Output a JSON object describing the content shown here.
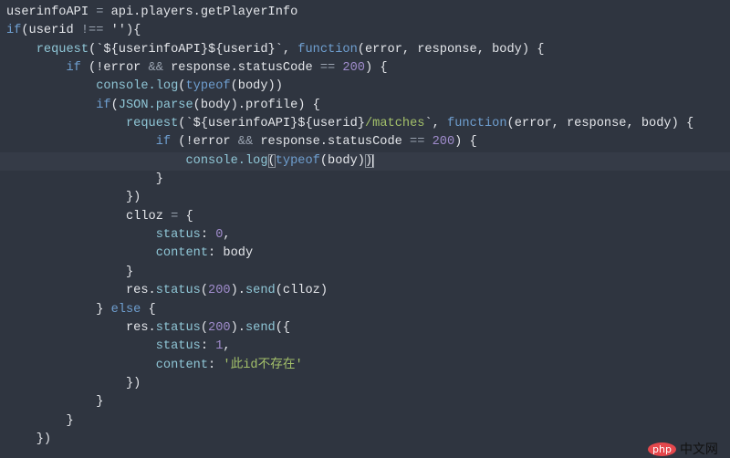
{
  "editor": {
    "current_line": 8,
    "colors": {
      "background": "#2f3540",
      "text": "#e4e6ea",
      "function": "#8fc6d6",
      "keyword": "#6f9fd0",
      "string": "#a3c06a",
      "number": "#a08ccc"
    },
    "lines": [
      [
        [
          "plain",
          "userinfoAPI "
        ],
        [
          "op",
          "="
        ],
        [
          "plain",
          " api.players.getPlayerInfo"
        ]
      ],
      [
        [
          "kw",
          "if"
        ],
        [
          "plain",
          "(userid "
        ],
        [
          "op",
          "!=="
        ],
        [
          "plain",
          " ''){"
        ]
      ],
      [
        [
          "plain",
          "    "
        ],
        [
          "fn",
          "request"
        ],
        [
          "plain",
          "(`${userinfoAPI}${userid}`, "
        ],
        [
          "kw",
          "function"
        ],
        [
          "plain",
          "(error, response, body) {"
        ]
      ],
      [
        [
          "plain",
          "        "
        ],
        [
          "kw",
          "if"
        ],
        [
          "plain",
          " (!error "
        ],
        [
          "op",
          "&&"
        ],
        [
          "plain",
          " response.statusCode "
        ],
        [
          "op",
          "=="
        ],
        [
          "plain",
          " "
        ],
        [
          "num",
          "200"
        ],
        [
          "plain",
          ") {"
        ]
      ],
      [
        [
          "plain",
          "            "
        ],
        [
          "fn",
          "console.log"
        ],
        [
          "plain",
          "("
        ],
        [
          "kw",
          "typeof"
        ],
        [
          "plain",
          "(body))"
        ]
      ],
      [
        [
          "plain",
          "            "
        ],
        [
          "kw",
          "if"
        ],
        [
          "plain",
          "("
        ],
        [
          "fn",
          "JSON.parse"
        ],
        [
          "plain",
          "(body).profile) {"
        ]
      ],
      [
        [
          "plain",
          "                "
        ],
        [
          "fn",
          "request"
        ],
        [
          "plain",
          "(`${userinfoAPI}${userid}"
        ],
        [
          "str",
          "/matches"
        ],
        [
          "plain",
          "`, "
        ],
        [
          "kw",
          "function"
        ],
        [
          "plain",
          "(error, response, body) {"
        ]
      ],
      [
        [
          "plain",
          "                    "
        ],
        [
          "kw",
          "if"
        ],
        [
          "plain",
          " (!error "
        ],
        [
          "op",
          "&&"
        ],
        [
          "plain",
          " response.statusCode "
        ],
        [
          "op",
          "=="
        ],
        [
          "plain",
          " "
        ],
        [
          "num",
          "200"
        ],
        [
          "plain",
          ") {"
        ]
      ],
      [
        [
          "plain",
          "                        "
        ],
        [
          "fn",
          "console.log"
        ],
        [
          "bracket",
          "("
        ],
        [
          "kw",
          "typeof"
        ],
        [
          "plain",
          "(body)"
        ],
        [
          "bracketcursor",
          ")"
        ]
      ],
      [
        [
          "plain",
          "                    }"
        ]
      ],
      [
        [
          "plain",
          "                })"
        ]
      ],
      [
        [
          "plain",
          "                clloz "
        ],
        [
          "op",
          "="
        ],
        [
          "plain",
          " {"
        ]
      ],
      [
        [
          "plain",
          "                    "
        ],
        [
          "fn",
          "status"
        ],
        [
          "plain",
          ": "
        ],
        [
          "num",
          "0"
        ],
        [
          "plain",
          ","
        ]
      ],
      [
        [
          "plain",
          "                    "
        ],
        [
          "fn",
          "content"
        ],
        [
          "plain",
          ": body"
        ]
      ],
      [
        [
          "plain",
          "                }"
        ]
      ],
      [
        [
          "plain",
          "                res."
        ],
        [
          "fn",
          "status"
        ],
        [
          "plain",
          "("
        ],
        [
          "num",
          "200"
        ],
        [
          "plain",
          ")."
        ],
        [
          "fn",
          "send"
        ],
        [
          "plain",
          "(clloz)"
        ]
      ],
      [
        [
          "plain",
          "            } "
        ],
        [
          "kw",
          "else"
        ],
        [
          "plain",
          " {"
        ]
      ],
      [
        [
          "plain",
          "                res."
        ],
        [
          "fn",
          "status"
        ],
        [
          "plain",
          "("
        ],
        [
          "num",
          "200"
        ],
        [
          "plain",
          ")."
        ],
        [
          "fn",
          "send"
        ],
        [
          "plain",
          "({"
        ]
      ],
      [
        [
          "plain",
          "                    "
        ],
        [
          "fn",
          "status"
        ],
        [
          "plain",
          ": "
        ],
        [
          "num",
          "1"
        ],
        [
          "plain",
          ","
        ]
      ],
      [
        [
          "plain",
          "                    "
        ],
        [
          "fn",
          "content"
        ],
        [
          "plain",
          ": "
        ],
        [
          "str",
          "'此id不存在'"
        ]
      ],
      [
        [
          "plain",
          "                })"
        ]
      ],
      [
        [
          "plain",
          "            }"
        ]
      ],
      [
        [
          "plain",
          "        }"
        ]
      ],
      [
        [
          "plain",
          "    })"
        ]
      ]
    ]
  },
  "watermark": {
    "logo": "php",
    "text": "中文网"
  }
}
